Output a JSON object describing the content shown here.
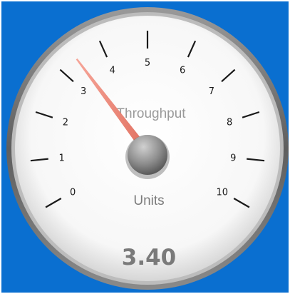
{
  "gauge": {
    "title": "Throughput",
    "units": "Units",
    "value_text": "3.40",
    "value": 3.4,
    "min": 0,
    "max": 10,
    "tick_labels": [
      "0",
      "1",
      "2",
      "3",
      "4",
      "5",
      "6",
      "7",
      "8",
      "9",
      "10"
    ]
  },
  "colors": {
    "background": "#0a6fd0",
    "needle": "#f08a7a",
    "face": "#ffffff",
    "bezel": "#6b6b6b"
  },
  "icons": {
    "hub": "needle-hub-icon"
  }
}
